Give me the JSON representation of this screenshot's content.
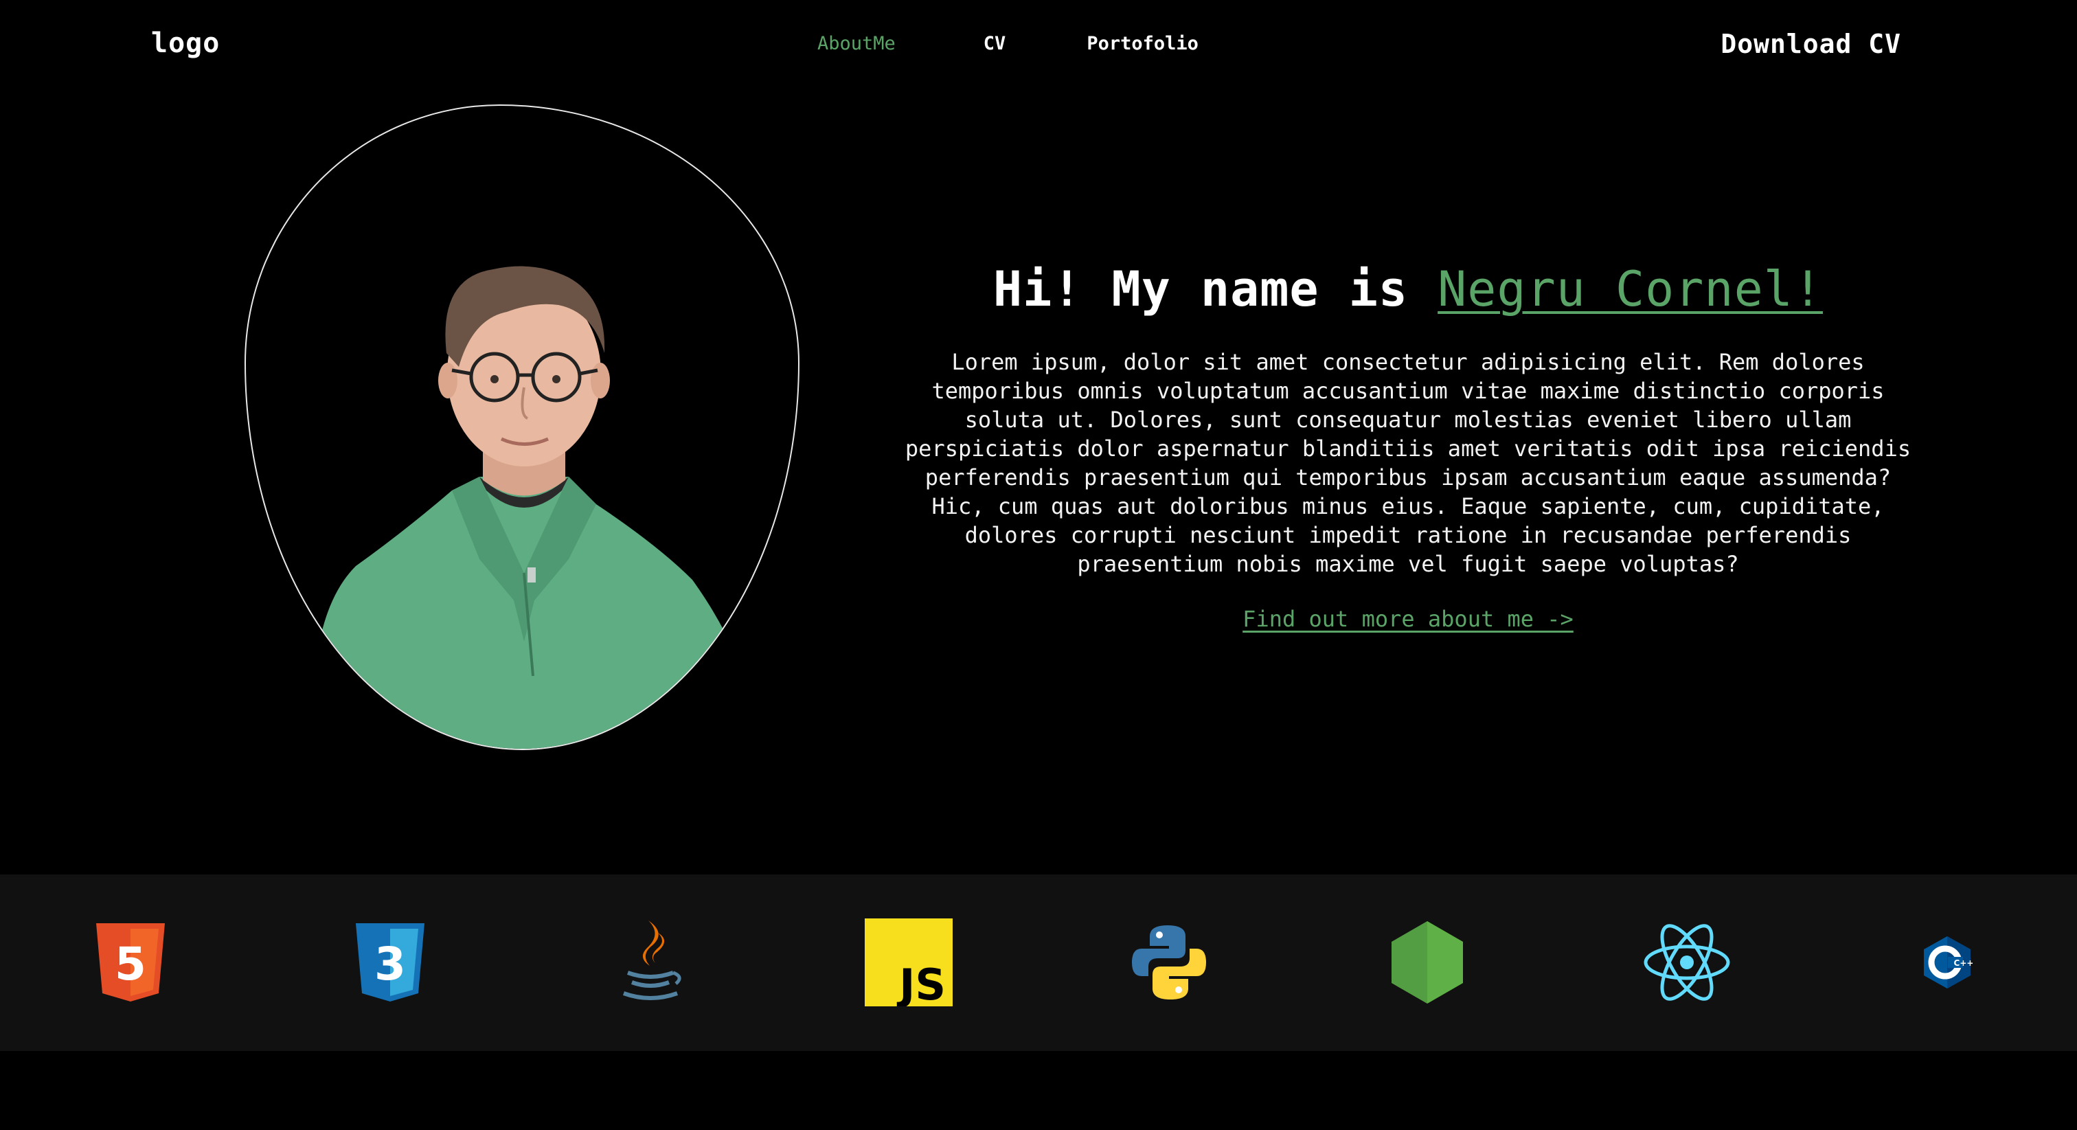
{
  "header": {
    "logo": "logo",
    "nav": [
      {
        "label": "AboutMe",
        "active": true
      },
      {
        "label": "CV",
        "active": false
      },
      {
        "label": "Portofolio",
        "active": false
      }
    ],
    "download_label": "Download CV"
  },
  "hero": {
    "greeting": "Hi! My name is ",
    "name": "Negru Cornel!",
    "bio": "Lorem ipsum, dolor sit amet consectetur adipisicing elit. Rem dolores temporibus omnis voluptatum accusantium vitae maxime distinctio corporis soluta ut. Dolores, sunt consequatur molestias eveniet libero ullam perspiciatis dolor aspernatur blanditiis amet veritatis odit ipsa reiciendis perferendis praesentium qui temporibus ipsam accusantium eaque assumenda? Hic, cum quas aut doloribus minus eius. Eaque sapiente, cum, cupiditate, dolores corrupti nesciunt impedit ratione in recusandae perferendis praesentium nobis maxime vel fugit saepe voluptas?",
    "more_link": "Find out more about me ->"
  },
  "tech": [
    {
      "icon": "html5-icon",
      "text": "5"
    },
    {
      "icon": "css3-icon",
      "text": "3"
    },
    {
      "icon": "java-icon"
    },
    {
      "icon": "javascript-icon",
      "text": "JS"
    },
    {
      "icon": "python-icon"
    },
    {
      "icon": "nodejs-icon"
    },
    {
      "icon": "react-icon"
    },
    {
      "icon": "cpp-icon",
      "text": "C++"
    }
  ],
  "colors": {
    "accent": "#5aa468",
    "background": "#000000",
    "strip": "#111111",
    "sweater": "#5fae83"
  }
}
